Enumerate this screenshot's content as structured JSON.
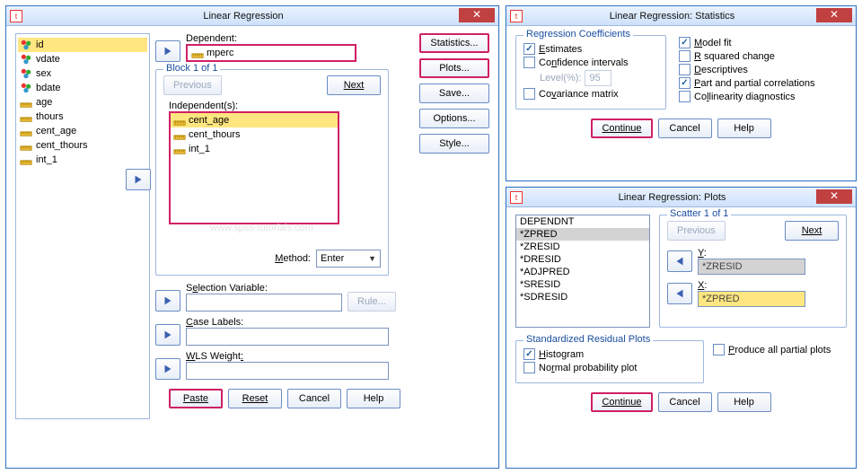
{
  "main": {
    "title": "Linear Regression",
    "vars": [
      {
        "name": "id",
        "type": "nom"
      },
      {
        "name": "vdate",
        "type": "nom"
      },
      {
        "name": "sex",
        "type": "nom"
      },
      {
        "name": "bdate",
        "type": "nom"
      },
      {
        "name": "age",
        "type": "scale"
      },
      {
        "name": "thours",
        "type": "scale"
      },
      {
        "name": "cent_age",
        "type": "scale"
      },
      {
        "name": "cent_thours",
        "type": "scale"
      },
      {
        "name": "int_1",
        "type": "scale"
      }
    ],
    "dependent_label": "Dependent:",
    "dependent_value": "mperc",
    "block_label": "Block 1 of 1",
    "prev": "Previous",
    "next": "Next",
    "independent_label": "Independent(s):",
    "independents": [
      "cent_age",
      "cent_thours",
      "int_1"
    ],
    "method_label": "Method:",
    "method_value": "Enter",
    "selection_label": "Selection Variable:",
    "rule": "Rule...",
    "case_label": "Case Labels:",
    "wls_label": "WLS Weight:",
    "side": {
      "stats": "Statistics...",
      "plots": "Plots...",
      "save": "Save...",
      "options": "Options...",
      "style": "Style..."
    },
    "bottom": {
      "paste": "Paste",
      "reset": "Reset",
      "cancel": "Cancel",
      "help": "Help"
    },
    "watermark": "www.spss-tutorials.com"
  },
  "stats": {
    "title": "Linear Regression: Statistics",
    "group1": "Regression Coefficients",
    "estimates": "Estimates",
    "conf": "Confidence intervals",
    "level": "Level(%):",
    "level_val": "95",
    "cov": "Covariance matrix",
    "modelfit": "Model fit",
    "r2": "R squared change",
    "desc": "Descriptives",
    "part": "Part and partial correlations",
    "coll": "Collinearity diagnostics",
    "cont": "Continue",
    "cancel": "Cancel",
    "help": "Help"
  },
  "plots": {
    "title": "Linear Regression: Plots",
    "list": [
      "DEPENDNT",
      "*ZPRED",
      "*ZRESID",
      "*DRESID",
      "*ADJPRED",
      "*SRESID",
      "*SDRESID"
    ],
    "scatter": "Scatter 1 of 1",
    "prev": "Previous",
    "next": "Next",
    "ylabel": "Y:",
    "yval": "*ZRESID",
    "xlabel": "X:",
    "xval": "*ZPRED",
    "srp": "Standardized Residual Plots",
    "hist": "Histogram",
    "norm": "Normal probability plot",
    "allpartial": "Produce all partial plots",
    "cont": "Continue",
    "cancel": "Cancel",
    "help": "Help"
  }
}
